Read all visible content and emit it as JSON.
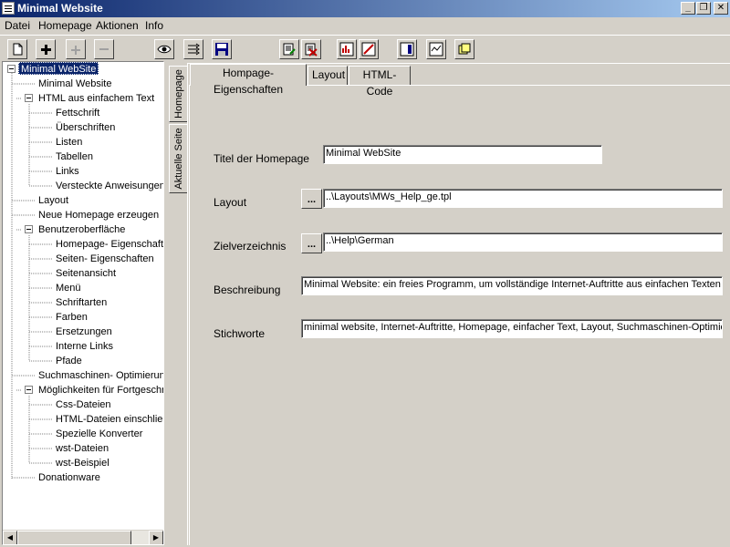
{
  "window": {
    "title": "Minimal Website",
    "buttons": {
      "minimize": "_",
      "maximize": "❐",
      "close": "✕"
    }
  },
  "menu": [
    "Datei",
    "Homepage",
    "Aktionen",
    "Info"
  ],
  "toolbar": {
    "buttons": [
      {
        "icon": "new-page-icon",
        "glyph": "🗋"
      },
      {
        "icon": "plus-icon",
        "glyph": "+"
      },
      {
        "icon": "plus-disabled-icon",
        "glyph": "+"
      },
      {
        "icon": "minus-disabled-icon",
        "glyph": "−"
      },
      {
        "icon": "eye-icon",
        "glyph": "👁"
      },
      {
        "icon": "outline-icon",
        "glyph": "⇶"
      },
      {
        "icon": "save-icon",
        "glyph": "💾"
      },
      {
        "icon": "edit-page-icon",
        "glyph": "✎"
      },
      {
        "icon": "delete-page-icon",
        "glyph": "✗"
      },
      {
        "icon": "chart-icon",
        "glyph": "▥"
      },
      {
        "icon": "pen-icon",
        "glyph": "✏"
      },
      {
        "icon": "window-icon",
        "glyph": "▤"
      },
      {
        "icon": "preview-icon",
        "glyph": "▨"
      },
      {
        "icon": "copy-icon",
        "glyph": "❏"
      }
    ]
  },
  "tree": [
    {
      "label": "Minimal WebSite",
      "level": 0,
      "expander": true,
      "selected": true
    },
    {
      "label": "Minimal Website",
      "level": 1
    },
    {
      "label": "HTML aus einfachem Text",
      "level": 1,
      "expander": true
    },
    {
      "label": "Fettschrift",
      "level": 2
    },
    {
      "label": "Überschriften",
      "level": 2
    },
    {
      "label": "Listen",
      "level": 2
    },
    {
      "label": "Tabellen",
      "level": 2
    },
    {
      "label": "Links",
      "level": 2
    },
    {
      "label": "Versteckte Anweisungen",
      "level": 2
    },
    {
      "label": "Layout",
      "level": 1
    },
    {
      "label": "Neue Homepage erzeugen",
      "level": 1
    },
    {
      "label": "Benutzeroberfläche",
      "level": 1,
      "expander": true
    },
    {
      "label": "Homepage- Eigenschaften",
      "level": 2
    },
    {
      "label": "Seiten- Eigenschaften",
      "level": 2
    },
    {
      "label": "Seitenansicht",
      "level": 2
    },
    {
      "label": "Menü",
      "level": 2
    },
    {
      "label": "Schriftarten",
      "level": 2
    },
    {
      "label": "Farben",
      "level": 2
    },
    {
      "label": "Ersetzungen",
      "level": 2
    },
    {
      "label": "Interne Links",
      "level": 2
    },
    {
      "label": "Pfade",
      "level": 2
    },
    {
      "label": "Suchmaschinen- Optimierung",
      "level": 1
    },
    {
      "label": "Möglichkeiten für Fortgeschrittene",
      "level": 1,
      "expander": true
    },
    {
      "label": "Css-Dateien",
      "level": 2
    },
    {
      "label": "HTML-Dateien einschließen",
      "level": 2
    },
    {
      "label": "Spezielle Konverter",
      "level": 2
    },
    {
      "label": "wst-Dateien",
      "level": 2
    },
    {
      "label": "wst-Beispiel",
      "level": 2
    },
    {
      "label": "Donationware",
      "level": 1
    }
  ],
  "vertical_tabs": [
    "Homepage",
    "Aktuelle Seite"
  ],
  "tabs": [
    "Hompage-Eigenschaften",
    "Layout",
    "HTML-Code"
  ],
  "form": {
    "titel": {
      "label": "Titel der Homepage",
      "value": "Minimal WebSite"
    },
    "layout": {
      "label": "Layout",
      "button": "...",
      "value": "..\\Layouts\\MWs_Help_ge.tpl"
    },
    "zielverzeichnis": {
      "label": "Zielverzeichnis",
      "button": "...",
      "value": "..\\Help\\German"
    },
    "beschreibung": {
      "label": "Beschreibung",
      "value": "Minimal Website: ein freies Programm, um vollständige Internet-Auftritte aus einfachen Texten zu e"
    },
    "stichworte": {
      "label": "Stichworte",
      "value": "minimal website, Internet-Auftritte, Homepage, einfacher Text, Layout, Suchmaschinen-Optimierun"
    }
  },
  "scrollbar": {
    "left_arrow": "◀",
    "right_arrow": "▶"
  }
}
